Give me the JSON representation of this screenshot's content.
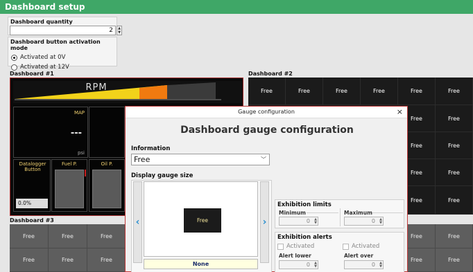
{
  "window": {
    "title": "Dashboard setup"
  },
  "quantity": {
    "label": "Dashboard quantity",
    "value": "2"
  },
  "activation": {
    "label": "Dashboard button activation mode",
    "options": [
      {
        "label": "Activated at 0V",
        "selected": true
      },
      {
        "label": "Activated at 12V",
        "selected": false
      }
    ]
  },
  "dashboard1": {
    "label": "Dashboard #1",
    "rpm_label": "RPM",
    "map": {
      "label": "MAP",
      "value": "---",
      "unit": "psi"
    },
    "datalogger": {
      "label": "Datalogger Button",
      "value": "0.0%"
    },
    "fuel_label": "Fuel P.",
    "oil_label": "Oil P."
  },
  "dashboard2": {
    "label": "Dashboard #2",
    "cell_label": "Free"
  },
  "dashboard3": {
    "label": "Dashboard #3",
    "cell_label": "Free"
  },
  "modal": {
    "window_title": "Gauge configuration",
    "close_glyph": "×",
    "heading": "Dashboard gauge configuration",
    "information": {
      "label": "Information",
      "value": "Free"
    },
    "size": {
      "label": "Display gauge size",
      "preview_label": "Free",
      "selected_value": "None"
    },
    "limits": {
      "label": "Exhibition limits",
      "minimum_label": "Minimum",
      "minimum_value": "0",
      "maximum_label": "Maximum",
      "maximum_value": "0"
    },
    "alerts": {
      "label": "Exhibition alerts",
      "activated_left": "Activated",
      "activated_right": "Activated",
      "lower_label": "Alert lower",
      "lower_value": "0",
      "over_label": "Alert over",
      "over_value": "0"
    }
  },
  "colors": {
    "titlebar": "#3fa767",
    "accent_orange": "#f07a10",
    "arrow_blue": "#2a8fcf",
    "modal_border": "#c03a3a"
  },
  "icons": {
    "prev": "chevron-left-icon",
    "next": "chevron-right-icon",
    "dropdown": "chevron-down-icon"
  }
}
